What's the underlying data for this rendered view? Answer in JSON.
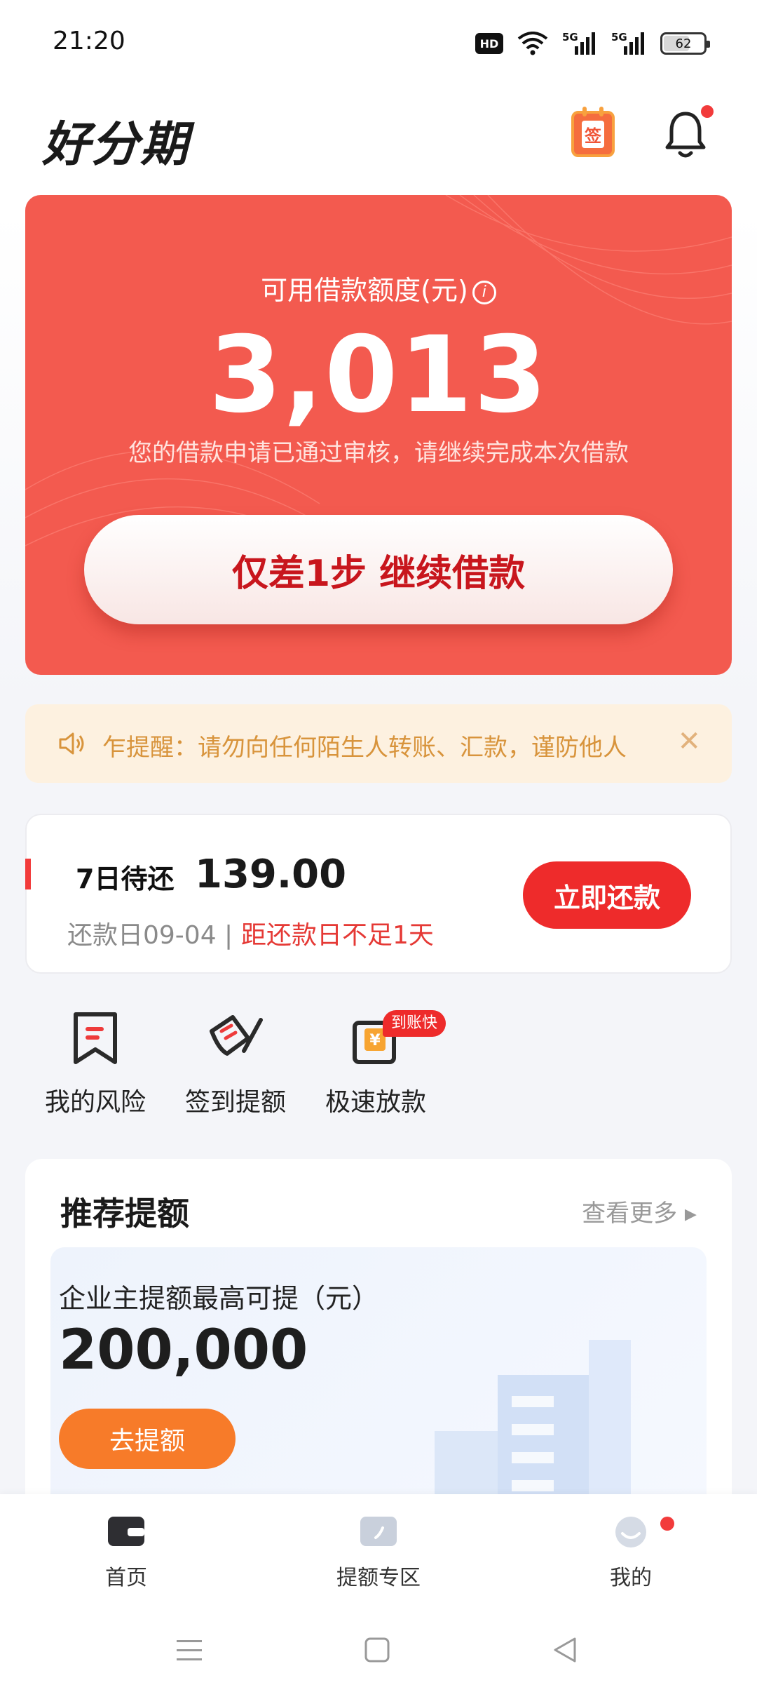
{
  "status_bar": {
    "time": "21:20",
    "hd_label": "HD",
    "signal_1": "5G",
    "signal_2": "5G",
    "battery": "62"
  },
  "header": {
    "logo": "好分期",
    "checkin_icon_label": "签",
    "notification_dot_color": "#f23b3b"
  },
  "credit": {
    "title": "可用借款额度(元)",
    "amount": "3,013",
    "description": "您的借款申请已通过审核，请继续完成本次借款",
    "button_label": "仅差1步 继续借款",
    "background_color": "#f35a4f"
  },
  "notice": {
    "text": "乍提醒：请勿向任何陌生人转账、汇款，谨防他人",
    "close_icon": "close-icon"
  },
  "repayment": {
    "label": "7日待还",
    "amount": "139.00",
    "due_date": "还款日09-04 |",
    "warning": "距还款日不足1天",
    "button_label": "立即还款"
  },
  "quick_actions": [
    {
      "label": "我的风险",
      "icon": "bookmark-icon"
    },
    {
      "label": "签到提额",
      "icon": "sign-pen-icon"
    },
    {
      "label": "极速放款",
      "icon": "wallet-yen-icon",
      "badge": "到账快"
    }
  ],
  "recommend": {
    "title": "推荐提额",
    "more_label": "查看更多 ▸",
    "subtitle": "企业主提额最高可提（元）",
    "amount": "200,000",
    "button_label": "去提额"
  },
  "bottom_nav": [
    {
      "label": "首页",
      "icon": "wallet-icon"
    },
    {
      "label": "提额专区",
      "icon": "quota-icon"
    },
    {
      "label": "我的",
      "icon": "avatar-icon"
    }
  ],
  "system_nav": {
    "menu": "menu-icon",
    "home": "home-square-icon",
    "back": "back-triangle-icon"
  }
}
